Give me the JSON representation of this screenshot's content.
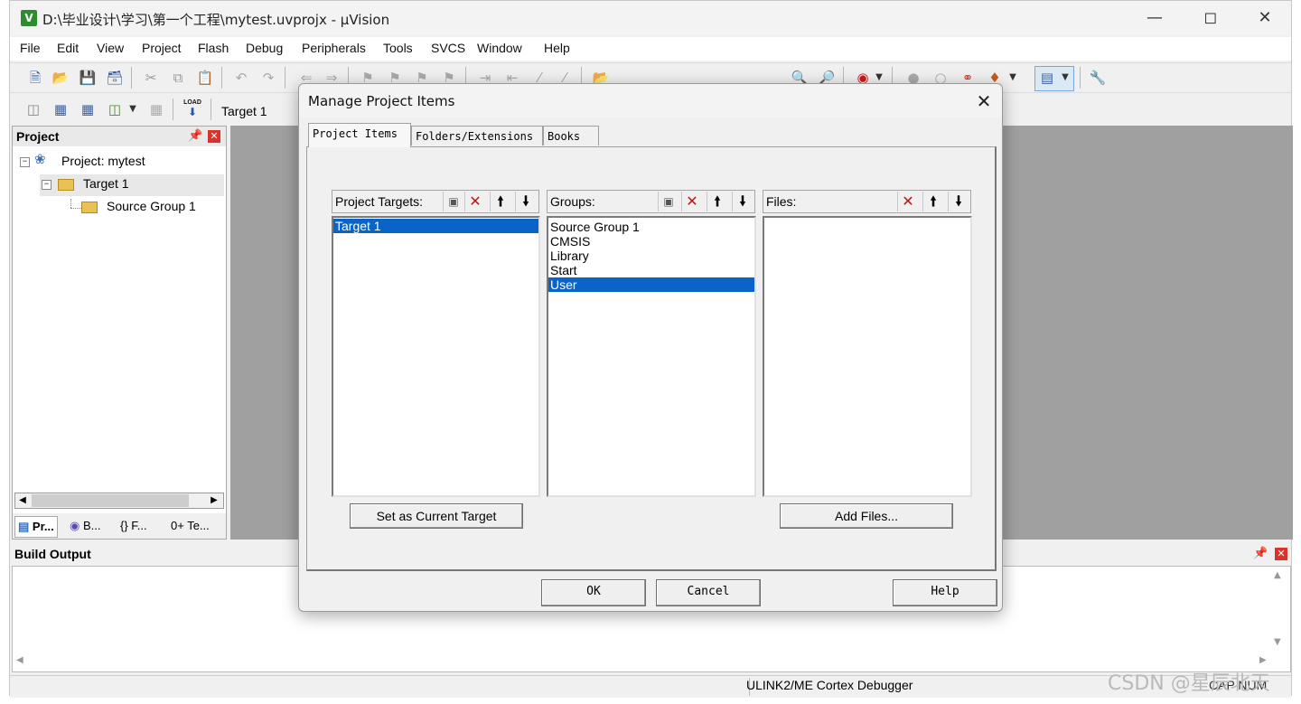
{
  "window": {
    "title": "D:\\毕业设计\\学习\\第一个工程\\mytest.uvprojx - µVision",
    "app_icon_text": "V",
    "minimize_icon": "minimize-icon",
    "maximize_icon": "maximize-icon",
    "close_icon": "close-icon"
  },
  "menu": [
    "File",
    "Edit",
    "View",
    "Project",
    "Flash",
    "Debug",
    "Peripherals",
    "Tools",
    "SVCS",
    "Window",
    "Help"
  ],
  "toolbar2": {
    "target": "Target 1",
    "load_icon_text": "LOAD"
  },
  "project_panel": {
    "title": "Project",
    "tree": {
      "project": "Project: mytest",
      "target": "Target 1",
      "group": "Source Group 1"
    },
    "tabs": [
      "Pr...",
      "B...",
      "{} F...",
      "0+ Te..."
    ]
  },
  "build_output": {
    "title": "Build Output"
  },
  "status": {
    "debugger": "ULINK2/ME Cortex Debugger",
    "caps": "CAP NUM"
  },
  "watermark": "CSDN @星辰北天",
  "dialog": {
    "title": "Manage Project Items",
    "tabs": [
      "Project Items",
      "Folders/Extensions",
      "Books"
    ],
    "active_tab": "Project Items",
    "targets": {
      "label": "Project Targets:",
      "items": [
        "Target 1"
      ],
      "selected": "Target 1"
    },
    "groups": {
      "label": "Groups:",
      "items": [
        "Source Group 1",
        "CMSIS",
        "Library",
        "Start",
        "User"
      ],
      "selected": "User"
    },
    "files": {
      "label": "Files:",
      "items": []
    },
    "set_current_target": "Set as Current Target",
    "add_files": "Add Files...",
    "ok": "OK",
    "cancel": "Cancel",
    "help": "Help"
  }
}
